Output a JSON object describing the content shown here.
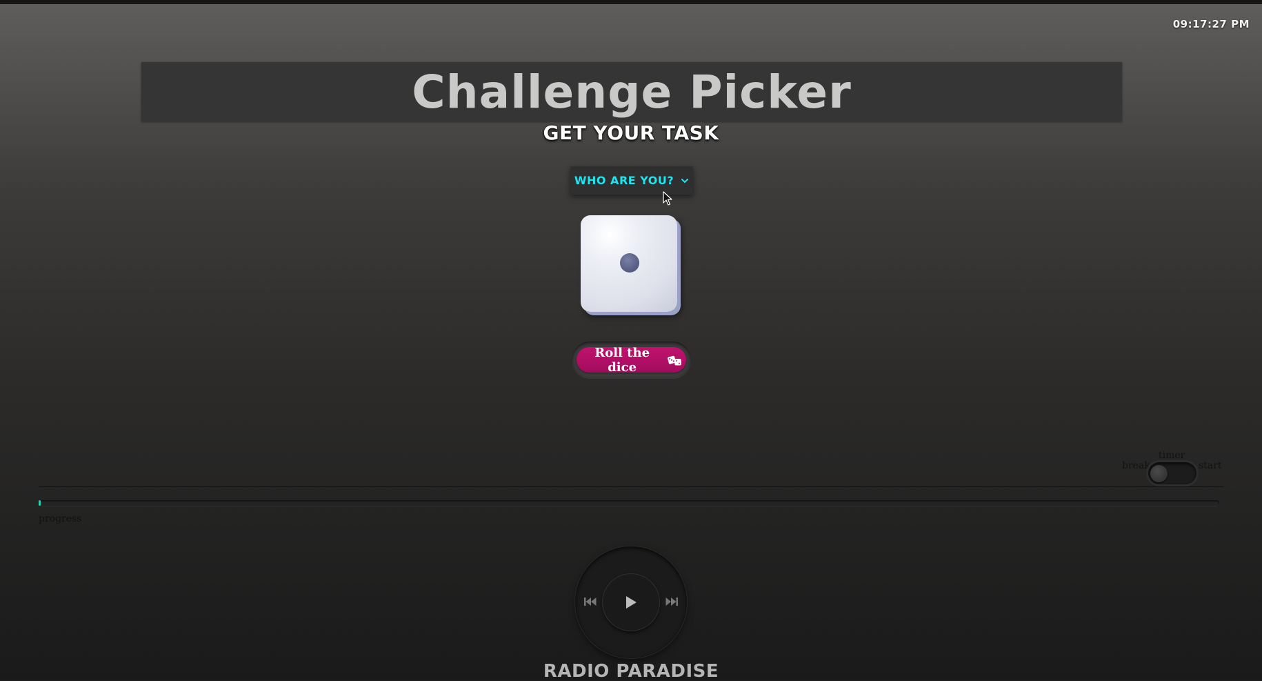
{
  "clock": {
    "time": "09:17:27 PM"
  },
  "header": {
    "title": "Challenge Picker",
    "subtitle": "GET YOUR TASK"
  },
  "player_select": {
    "label": "WHO ARE YOU?",
    "icon": "chevron-down-icon",
    "accent_color": "#1ee4f0"
  },
  "dice": {
    "face_value": 1,
    "roll_button_label": "Roll the dice",
    "roll_button_icon": "dice-icon",
    "button_color": "#b3106a"
  },
  "timer": {
    "caption": "timer",
    "left_label": "break",
    "right_label": "start",
    "state": "off"
  },
  "progress": {
    "label": "progress",
    "fraction": 0.002,
    "fill_color": "#23d0b4"
  },
  "radio": {
    "title": "RADIO PARADISE",
    "controls": [
      "previous-icon",
      "play-icon",
      "next-icon"
    ]
  }
}
